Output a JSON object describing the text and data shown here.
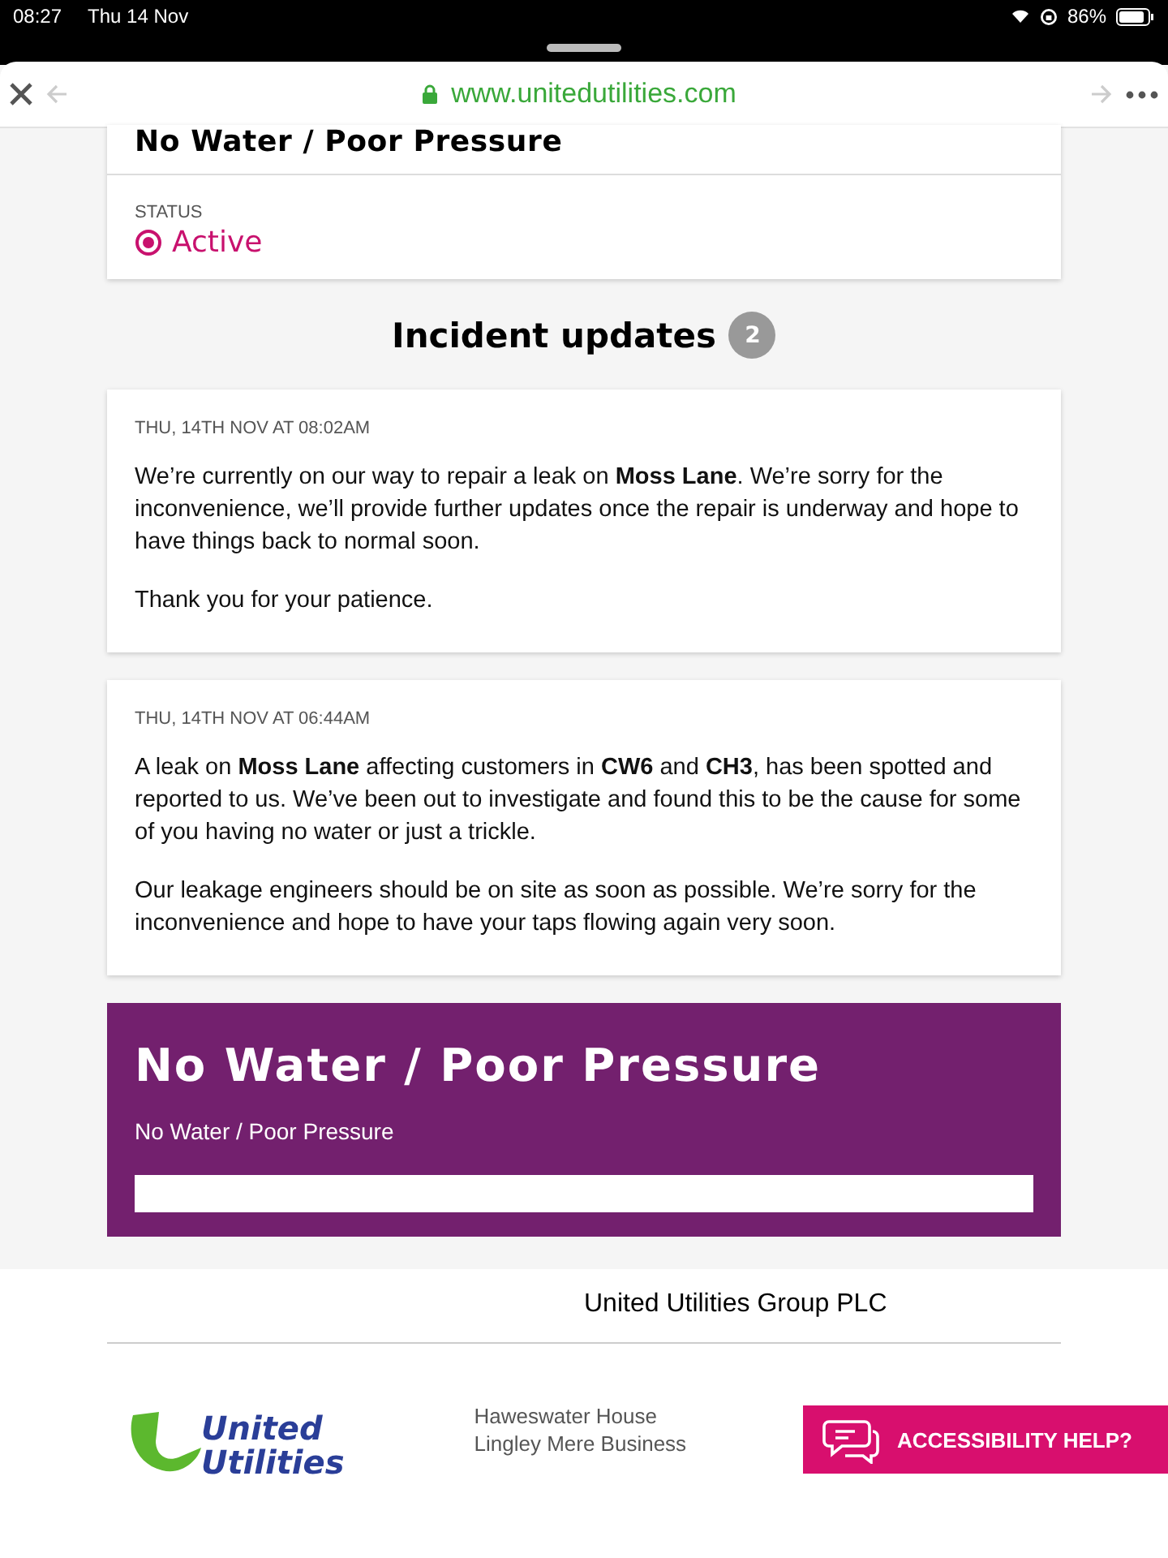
{
  "status_bar": {
    "time": "08:27",
    "date": "Thu 14 Nov",
    "battery": "86%"
  },
  "browser": {
    "url": "www.unitedutilities.com"
  },
  "incident": {
    "title": "No Water / Poor Pressure",
    "status_label": "STATUS",
    "status": "Active"
  },
  "updates": {
    "heading": "Incident updates",
    "count": "2",
    "items": [
      {
        "timestamp": "THU, 14TH NOV AT 08:02AM",
        "paragraphs": [
          "We’re currently on our way to repair a leak on **Moss Lane**. We’re sorry for the inconvenience, we’ll provide further updates once the repair is underway and hope to have things back to normal soon.",
          "Thank you for your patience."
        ]
      },
      {
        "timestamp": "THU, 14TH NOV AT 06:44AM",
        "paragraphs": [
          "A leak on **Moss Lane** affecting customers in **CW6** and **CH3**, has been spotted and reported to us. We’ve been out to investigate and found this to be the cause for some of you having no water or just a trickle.",
          "Our leakage engineers should be on site as soon as possible. We’re sorry for the inconvenience and hope to have your taps flowing again very soon."
        ]
      }
    ]
  },
  "banner": {
    "title": "No Water / Poor Pressure",
    "subtitle": "No Water / Poor Pressure"
  },
  "footer": {
    "company": "United Utilities Group PLC",
    "logo_line1": "United",
    "logo_line2": "Utilities",
    "address": [
      "Haweswater House",
      "Lingley Mere Business"
    ]
  },
  "accessibility_button": "ACCESSIBILITY HELP?"
}
